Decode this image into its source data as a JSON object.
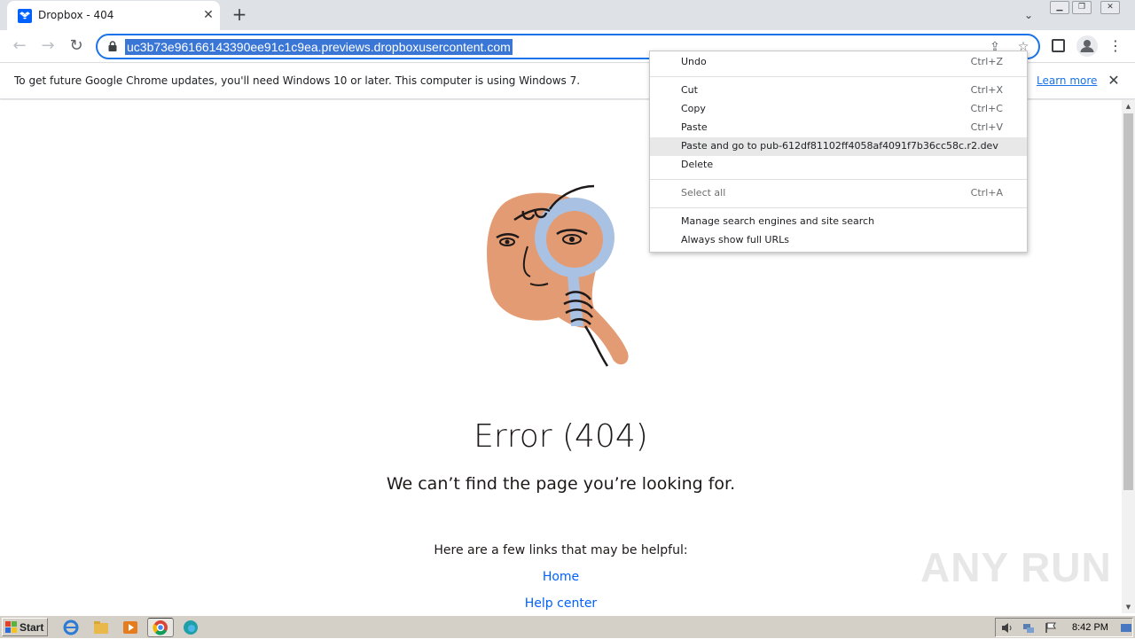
{
  "browser": {
    "tab_title": "Dropbox - 404",
    "url": "uc3b73e96166143390ee91c1c9ea.previews.dropboxusercontent.com"
  },
  "infobar": {
    "message": "To get future Google Chrome updates, you'll need Windows 10 or later. This computer is using Windows 7.",
    "link": "Learn more"
  },
  "context_menu": {
    "items": [
      {
        "label": "Undo",
        "shortcut": "Ctrl+Z"
      },
      {
        "label": "Cut",
        "shortcut": "Ctrl+X"
      },
      {
        "label": "Copy",
        "shortcut": "Ctrl+C"
      },
      {
        "label": "Paste",
        "shortcut": "Ctrl+V"
      },
      {
        "label": "Paste and go to pub-612df81102ff4058af4091f7b36cc58c.r2.dev",
        "shortcut": ""
      },
      {
        "label": "Delete",
        "shortcut": ""
      },
      {
        "label": "Select all",
        "shortcut": "Ctrl+A"
      },
      {
        "label": "Manage search engines and site search",
        "shortcut": ""
      },
      {
        "label": "Always show full URLs",
        "shortcut": ""
      }
    ]
  },
  "page": {
    "error_title": "Error (404)",
    "error_subtitle": "We can’t find the page you’re looking for.",
    "helpful_text": "Here are a few links that may be helpful:",
    "links": [
      "Home",
      "Help center"
    ],
    "watermark": "ANY RUN"
  },
  "taskbar": {
    "start_label": "Start",
    "clock": "8:42 PM"
  },
  "colors": {
    "accent": "#1a73e8",
    "dropbox_blue": "#0061fe",
    "selection": "#3a76d6"
  }
}
